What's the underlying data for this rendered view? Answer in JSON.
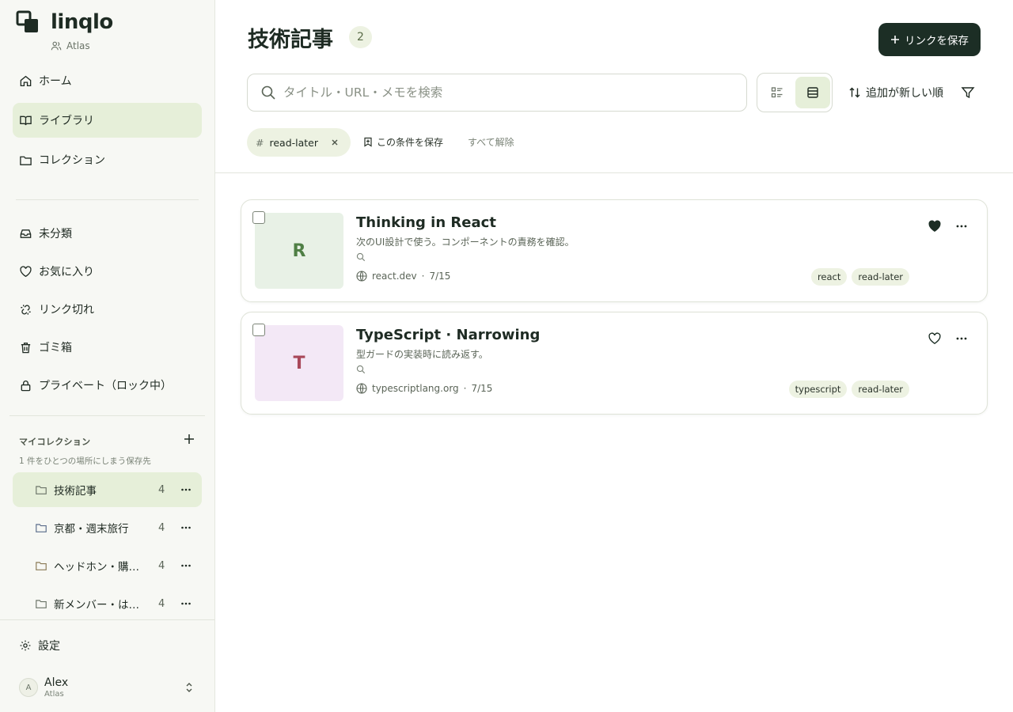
{
  "app": {
    "name": "linqlo",
    "workspace": "Atlas"
  },
  "nav": [
    {
      "label": "ホーム",
      "icon": "home-icon"
    },
    {
      "label": "ライブラリ",
      "icon": "book-icon"
    },
    {
      "label": "コレクション",
      "icon": "folder-icon"
    },
    {
      "label": "未分類",
      "icon": "inbox-icon"
    },
    {
      "label": "お気に入り",
      "icon": "heart-icon"
    },
    {
      "label": "リンク切れ",
      "icon": "broken-link-icon"
    },
    {
      "label": "ゴミ箱",
      "icon": "trash-icon"
    },
    {
      "label": "プライベート（ロック中）",
      "icon": "lock-icon"
    }
  ],
  "collections_section": {
    "title": "マイコレクション",
    "subtitle": "1 件をひとつの場所にしまう保存先",
    "items": [
      {
        "name": "技術記事",
        "count": "4"
      },
      {
        "name": "京都・週末旅行",
        "count": "4"
      },
      {
        "name": "ヘッドホン・購入検討",
        "count": "4"
      },
      {
        "name": "新メンバー・はじめに",
        "count": "4"
      }
    ]
  },
  "settings_label": "設定",
  "user": {
    "initial": "A",
    "name": "Alex",
    "workspace": "Atlas"
  },
  "header": {
    "title": "技術記事",
    "count": "2",
    "save_link_label": "リンクを保存"
  },
  "search": {
    "placeholder": "タイトル・URL・メモを検索",
    "value": ""
  },
  "sort_label": "追加が新しい順",
  "filters": {
    "chip_hash": "#",
    "chip_label": "read-later",
    "save_condition_label": "この条件を保存",
    "clear_all_label": "すべて解除"
  },
  "cards": [
    {
      "initial": "R",
      "thumb_bg": "#e8f1e6",
      "thumb_color": "#4f7f45",
      "title": "Thinking in React",
      "note": "次のUI設計で使う。コンポーネントの責務を確認。",
      "domain": "react.dev",
      "date": "7/15",
      "favorite": true,
      "tags": [
        "react",
        "read-later"
      ]
    },
    {
      "initial": "T",
      "thumb_bg": "#f3e8f6",
      "thumb_color": "#a8485a",
      "title": "TypeScript · Narrowing",
      "note": "型ガードの実装時に読み返す。",
      "domain": "typescriptlang.org",
      "date": "7/15",
      "favorite": false,
      "tags": [
        "typescript",
        "read-later"
      ]
    }
  ],
  "colors": {
    "accent": "#1c2e25",
    "active_bg": "#e6efd9",
    "chip_bg": "#edf2e2"
  },
  "dot": "·"
}
